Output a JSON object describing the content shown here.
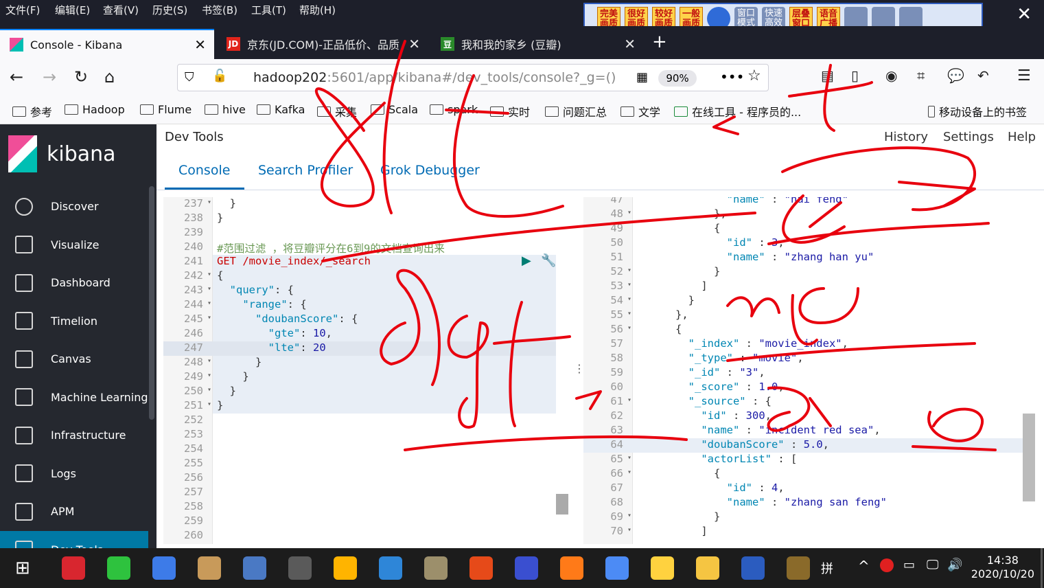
{
  "menubar": {
    "items": [
      "文件(F)",
      "编辑(E)",
      "查看(V)",
      "历史(S)",
      "书签(B)",
      "工具(T)",
      "帮助(H)"
    ]
  },
  "ext_toolbar": {
    "buttons": [
      "完美画质",
      "很好画质",
      "较好画质",
      "一般画质",
      "窗口模式",
      "快速高效",
      "层叠窗口",
      "语音广播"
    ]
  },
  "tabs": [
    {
      "label": "Console - Kibana",
      "icon": "kibana-icon"
    },
    {
      "label": "京东(JD.COM)-正品低价、品质",
      "icon": "jd-icon",
      "badge": "JD"
    },
    {
      "label": "我和我的家乡 (豆瓣)",
      "icon": "douban-icon",
      "badge": "豆"
    }
  ],
  "nav": {
    "url_host": "hadoop202",
    "url_rest": ":5601/app/kibana#/dev_tools/console?_g=()",
    "zoom": "90%"
  },
  "bookmarks": [
    "参考",
    "Hadoop",
    "Flume",
    "hive",
    "Kafka",
    "采集",
    "Scala",
    "spark",
    "实时",
    "问题汇总",
    "文学",
    "在线工具 - 程序员的...",
    "移动设备上的书签"
  ],
  "sidebar": {
    "brand": "kibana",
    "items": [
      "Discover",
      "Visualize",
      "Dashboard",
      "Timelion",
      "Canvas",
      "Machine Learning",
      "Infrastructure",
      "Logs",
      "APM",
      "Dev Tools"
    ]
  },
  "devtools": {
    "title": "Dev Tools",
    "links": [
      "History",
      "Settings",
      "Help"
    ],
    "tabs": [
      "Console",
      "Search Profiler",
      "Grok Debugger"
    ]
  },
  "editor": {
    "lines": [
      {
        "n": "237",
        "t": "  }"
      },
      {
        "n": "238",
        "t": "}"
      },
      {
        "n": "239",
        "t": ""
      },
      {
        "n": "240",
        "t": "#范围过滤 ，将豆瓣评分在6到9的文档查询出来"
      },
      {
        "n": "241",
        "t": "GET /movie_index/_search"
      },
      {
        "n": "242",
        "t": "{"
      },
      {
        "n": "243",
        "t": "  \"query\": {"
      },
      {
        "n": "244",
        "t": "    \"range\": {"
      },
      {
        "n": "245",
        "t": "      \"doubanScore\": {"
      },
      {
        "n": "246",
        "t": "        \"gte\": 10,"
      },
      {
        "n": "247",
        "t": "        \"lte\": 20"
      },
      {
        "n": "248",
        "t": "      }"
      },
      {
        "n": "249",
        "t": "    }"
      },
      {
        "n": "250",
        "t": "  }"
      },
      {
        "n": "251",
        "t": "}"
      },
      {
        "n": "252",
        "t": ""
      },
      {
        "n": "253",
        "t": ""
      },
      {
        "n": "254",
        "t": ""
      },
      {
        "n": "255",
        "t": ""
      },
      {
        "n": "256",
        "t": ""
      },
      {
        "n": "257",
        "t": ""
      },
      {
        "n": "258",
        "t": ""
      },
      {
        "n": "259",
        "t": ""
      },
      {
        "n": "260",
        "t": ""
      }
    ]
  },
  "output": {
    "lines": [
      {
        "n": "47",
        "t": "              \"name\" : \"hai feng\""
      },
      {
        "n": "48",
        "t": "            },"
      },
      {
        "n": "49",
        "t": "            {"
      },
      {
        "n": "50",
        "t": "              \"id\" : 3,"
      },
      {
        "n": "51",
        "t": "              \"name\" : \"zhang han yu\""
      },
      {
        "n": "52",
        "t": "            }"
      },
      {
        "n": "53",
        "t": "          ]"
      },
      {
        "n": "54",
        "t": "        }"
      },
      {
        "n": "55",
        "t": "      },"
      },
      {
        "n": "56",
        "t": "      {"
      },
      {
        "n": "57",
        "t": "        \"_index\" : \"movie_index\","
      },
      {
        "n": "58",
        "t": "        \"_type\" : \"movie\","
      },
      {
        "n": "59",
        "t": "        \"_id\" : \"3\","
      },
      {
        "n": "60",
        "t": "        \"_score\" : 1.0,"
      },
      {
        "n": "61",
        "t": "        \"_source\" : {"
      },
      {
        "n": "62",
        "t": "          \"id\" : 300,"
      },
      {
        "n": "63",
        "t": "          \"name\" : \"incident red sea\","
      },
      {
        "n": "64",
        "t": "          \"doubanScore\" : 5.0,"
      },
      {
        "n": "65",
        "t": "          \"actorList\" : ["
      },
      {
        "n": "66",
        "t": "            {"
      },
      {
        "n": "67",
        "t": "              \"id\" : 4,"
      },
      {
        "n": "68",
        "t": "              \"name\" : \"zhang san feng\""
      },
      {
        "n": "69",
        "t": "            }"
      },
      {
        "n": "70",
        "t": "          ]"
      }
    ]
  },
  "taskbar": {
    "time": "14:38",
    "date": "2020/10/20",
    "ime": "拼"
  }
}
